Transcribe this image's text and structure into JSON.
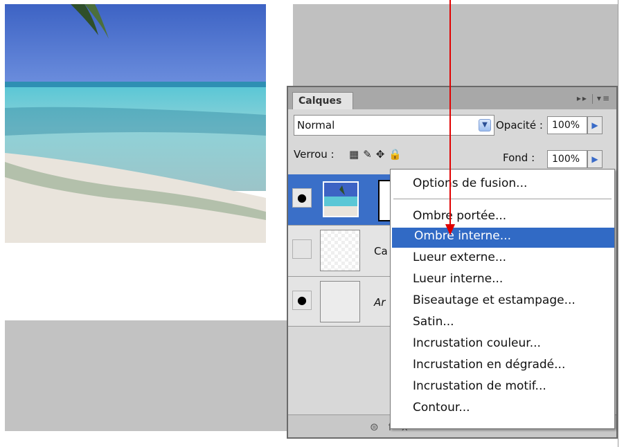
{
  "panel": {
    "tab_label": "Calques",
    "tab_buttons": "▸▸",
    "tab_menu": "▾≡",
    "blend_mode": "Normal",
    "opacity_label": "Opacité :",
    "opacity_value": "100%",
    "lock_label": "Verrou :",
    "fill_label": "Fond :",
    "fill_value": "100%",
    "layers": [
      {
        "name": "",
        "visible": true,
        "selected": true
      },
      {
        "name": "Ca",
        "visible": false,
        "selected": false
      },
      {
        "name": "Ar",
        "visible": true,
        "selected": false
      }
    ]
  },
  "context_menu": {
    "items": [
      {
        "label": "Options de fusion...",
        "selected": false
      },
      {
        "label": "Ombre portée...",
        "selected": false
      },
      {
        "label": "Ombre interne...",
        "selected": true
      },
      {
        "label": "Lueur externe...",
        "selected": false
      },
      {
        "label": "Lueur interne...",
        "selected": false
      },
      {
        "label": "Biseautage et estampage...",
        "selected": false
      },
      {
        "label": "Satin...",
        "selected": false
      },
      {
        "label": "Incrustation couleur...",
        "selected": false
      },
      {
        "label": "Incrustation en dégradé...",
        "selected": false
      },
      {
        "label": "Incrustation de motif...",
        "selected": false
      },
      {
        "label": "Contour...",
        "selected": false
      }
    ]
  },
  "colors": {
    "selection": "#316ac5",
    "annotation_arrow": "#e00000",
    "panel_bg": "#d8d8d8"
  },
  "icons": {
    "eye": "eye-icon",
    "lock_transparency": "checker-lock-icon",
    "lock_paint": "brush-lock-icon",
    "lock_move": "move-lock-icon",
    "lock_all": "padlock-icon",
    "link": "link-icon",
    "fx": "fx-icon"
  }
}
